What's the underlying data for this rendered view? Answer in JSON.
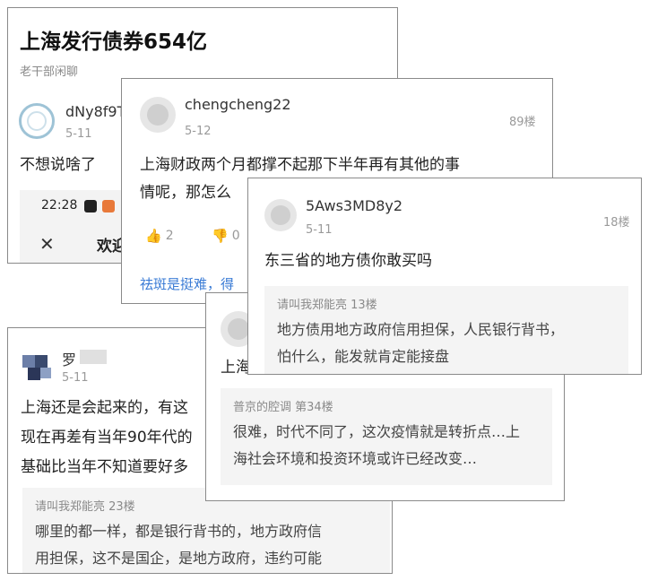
{
  "card1": {
    "title": "上海发行债券654亿",
    "source": "老干部闲聊",
    "username": "dNy8f9T",
    "date": "5-11",
    "text": "不想说啥了",
    "embedded": {
      "time": "22:28",
      "caption": "欢迎"
    }
  },
  "card2": {
    "username": "chengcheng22",
    "date": "5-12",
    "floor": "89楼",
    "text_line1": "上海财政两个月都撑不起那下半年再有其他的事",
    "text_line2": "情呢，那怎么",
    "like_count": "2",
    "dislike_count": "0",
    "link_text": "祛斑是挺难，得"
  },
  "card3": {
    "username": "5Aws3MD8y2",
    "date": "5-11",
    "floor": "18楼",
    "text": "东三省的地方债你敢买吗",
    "quote": {
      "head": "请叫我郑能亮 13楼",
      "line1": "地方债用地方政府信用担保，人民银行背书，",
      "line2": "怕什么，能发就肯定能接盘"
    }
  },
  "card4": {
    "username": "罗",
    "date": "5-11",
    "line1": "上海还是会起来的，有这",
    "line2": "现在再差有当年90年代的",
    "line3": "基础比当年不知道要好多",
    "quote": {
      "head": "请叫我郑能亮 23楼",
      "line1": "哪里的都一样，都是银行背书的，地方政府信",
      "line2": "用担保，这不是国企，是地方政府，违约可能"
    }
  },
  "card5": {
    "partial_text": "上海",
    "quote": {
      "head": "普京的腔调 第34楼",
      "line1": "很难，时代不同了，这次疫情就是转折点…上",
      "line2": "海社会环境和投资环境或许已经改变…"
    }
  },
  "colors": {
    "link": "#3a7bd5",
    "border": "#8a8a8a",
    "quote_bg": "#f4f4f4"
  }
}
